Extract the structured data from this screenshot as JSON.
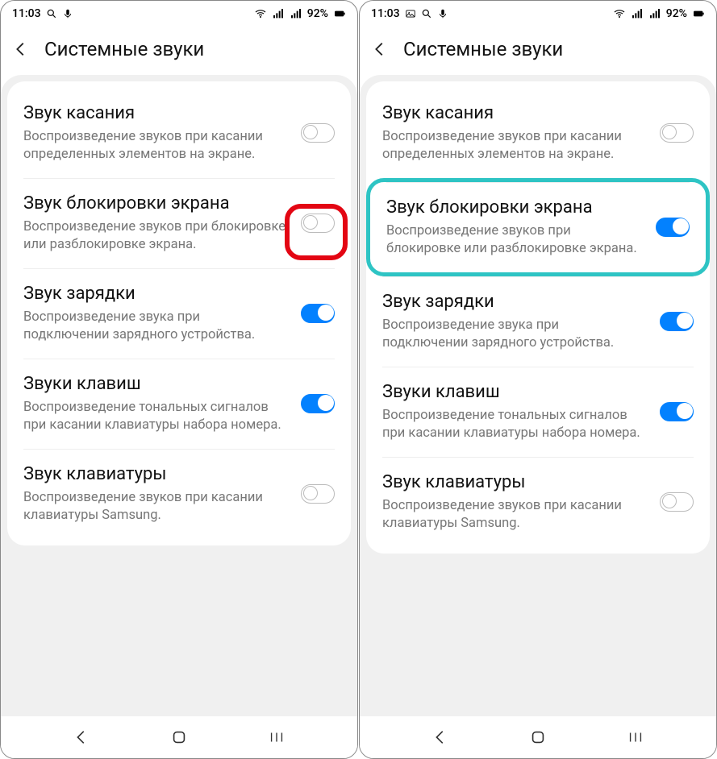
{
  "status": {
    "time": "11:03",
    "battery_pct": "92%"
  },
  "header": {
    "title": "Системные звуки"
  },
  "items": {
    "touch": {
      "title": "Звук касания",
      "desc": "Воспроизведение звуков при касании определенных элементов на экране."
    },
    "lock": {
      "title": "Звук блокировки экрана",
      "desc": "Воспроизведение звуков при блокировке или разблокировке экрана."
    },
    "charge": {
      "title": "Звук зарядки",
      "desc": "Воспроизведение звука при подключении зарядного устройства."
    },
    "dial": {
      "title": "Звуки клавиш",
      "desc": "Воспроизведение тональных сигналов при касании клавиатуры набора номера."
    },
    "keyboard": {
      "title": "Звук клавиатуры",
      "desc": "Воспроизведение звуков при касании клавиатуры Samsung."
    }
  },
  "screens": {
    "left": {
      "lock_on": false,
      "highlight": "red"
    },
    "right": {
      "lock_on": true,
      "highlight": "teal"
    }
  }
}
